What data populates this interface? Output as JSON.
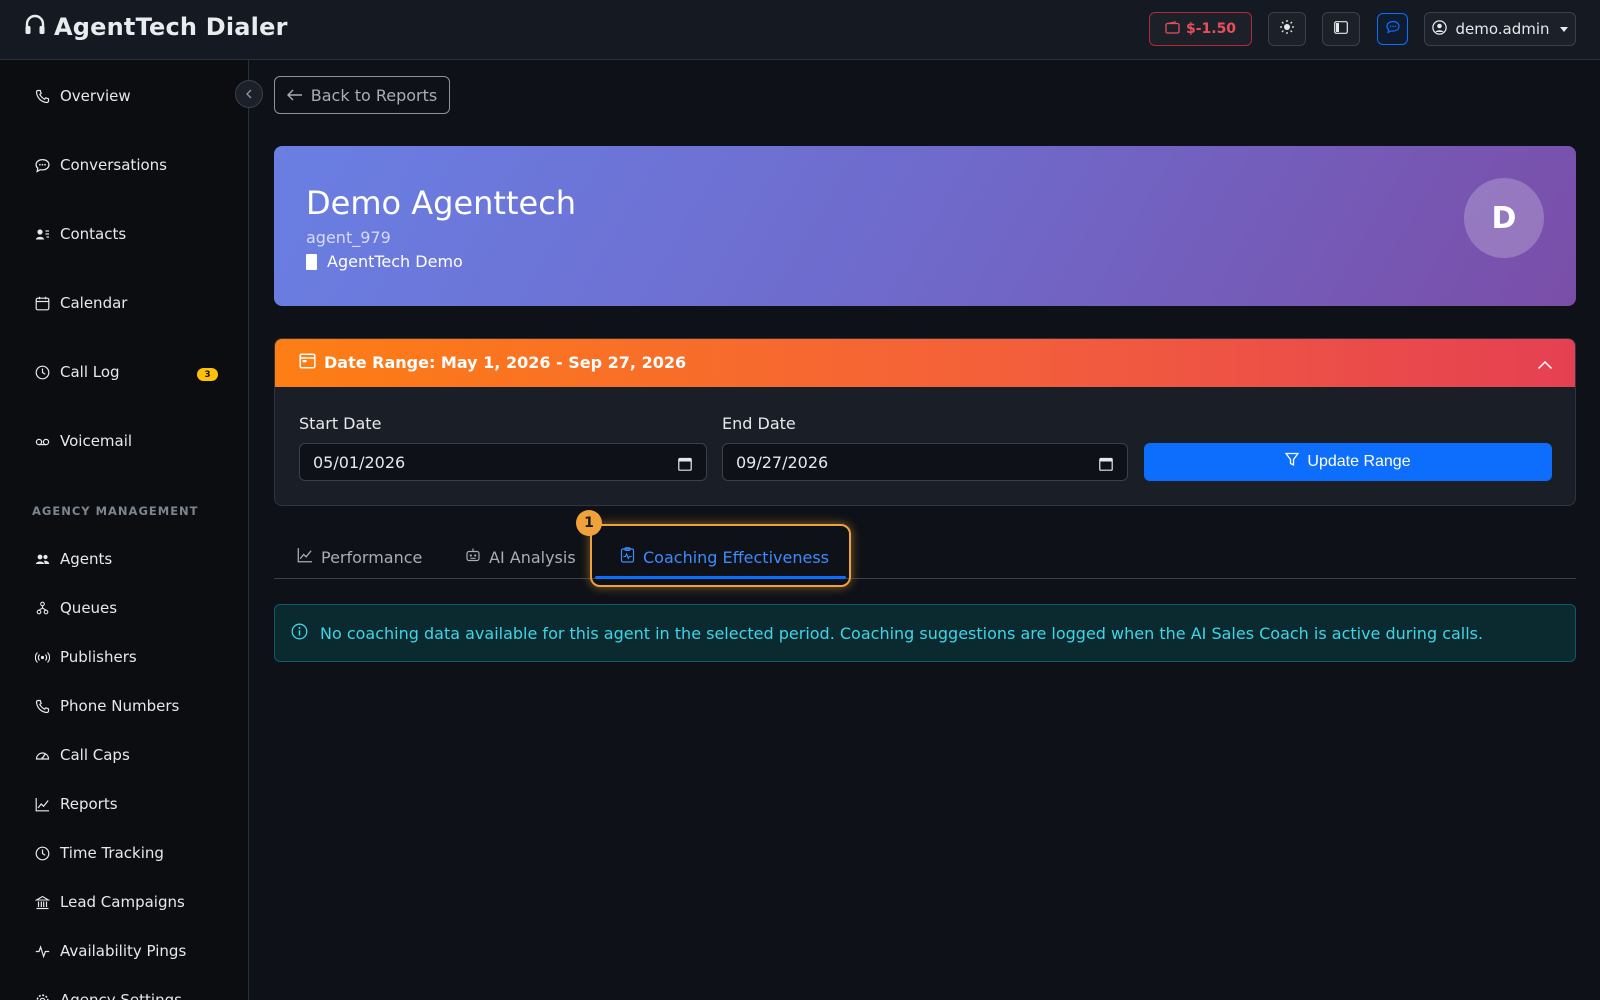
{
  "app": {
    "title": "AgentTech Dialer",
    "logo_icon": "headset-icon"
  },
  "header": {
    "balance": "$-1.50",
    "balance_icon": "wallet-icon",
    "theme_icon": "sun-icon",
    "layout_icon": "sidebar-toggle-icon",
    "chat_icon": "chat-icon",
    "user": "demo.admin",
    "colors": {
      "balance": "#ea4e5c",
      "chat_accent": "#0d6efd"
    }
  },
  "sidebar": {
    "items": [
      {
        "label": "Overview",
        "icon": "phone-icon"
      },
      {
        "label": "Conversations",
        "icon": "chat-icon"
      },
      {
        "label": "Contacts",
        "icon": "contacts-icon"
      },
      {
        "label": "Calendar",
        "icon": "calendar-icon"
      },
      {
        "label": "Call Log",
        "icon": "clock-icon",
        "badge": "3"
      },
      {
        "label": "Voicemail",
        "icon": "voicemail-icon"
      }
    ],
    "section_label": "AGENCY MANAGEMENT",
    "agency_items": [
      {
        "label": "Agents",
        "icon": "people-icon"
      },
      {
        "label": "Queues",
        "icon": "queue-icon"
      },
      {
        "label": "Publishers",
        "icon": "broadcast-icon"
      },
      {
        "label": "Phone Numbers",
        "icon": "phone-icon"
      },
      {
        "label": "Call Caps",
        "icon": "gauge-icon"
      },
      {
        "label": "Reports",
        "icon": "chart-line-icon"
      },
      {
        "label": "Time Tracking",
        "icon": "clock-icon"
      },
      {
        "label": "Lead Campaigns",
        "icon": "building-icon"
      },
      {
        "label": "Availability Pings",
        "icon": "activity-icon"
      },
      {
        "label": "Agency Settings",
        "icon": "gear-icon"
      }
    ]
  },
  "main": {
    "back_label": "Back to Reports",
    "agent": {
      "name": "Demo Agenttech",
      "id": "agent_979",
      "org": "AgentTech Demo",
      "avatar_initial": "D"
    },
    "date_range": {
      "title": "Date Range: May 1, 2026 - Sep 27, 2026",
      "start_label": "Start Date",
      "start_value": "05/01/2026",
      "end_label": "End Date",
      "end_value": "09/27/2026",
      "update_label": "Update Range"
    },
    "tabs": [
      {
        "label": "Performance",
        "icon": "chart-line-icon",
        "active": false
      },
      {
        "label": "AI Analysis",
        "icon": "robot-icon",
        "active": false
      },
      {
        "label": "Coaching Effectiveness",
        "icon": "clipboard-pulse-icon",
        "active": true
      }
    ],
    "highlight_marker": "1",
    "alert_text": "No coaching data available for this agent in the selected period. Coaching suggestions are logged when the AI Sales Coach is active during calls."
  }
}
